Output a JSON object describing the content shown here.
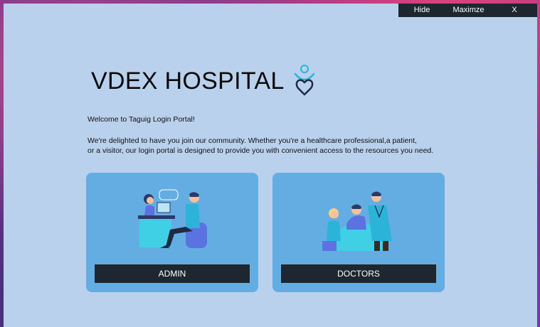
{
  "titlebar": {
    "hide": "Hide",
    "maximize": "Maximze",
    "close": "X"
  },
  "header": {
    "title": "VDEX HOSPITAL"
  },
  "content": {
    "welcome": "Welcome to Taguig Login Portal!",
    "line1": "We're delighted to have you join our community. Whether you're a healthcare professional,a patient,",
    "line2": "or a visitor, our login portal is designed to provide  you with convenient access to the resources you need."
  },
  "cards": {
    "admin_label": "ADMIN",
    "doctors_label": "DOCTORS"
  },
  "colors": {
    "window_bg": "#b9d1ec",
    "card_bg": "#64ade3",
    "button_bg": "#1e2730",
    "accent": "#2bb3d9"
  }
}
